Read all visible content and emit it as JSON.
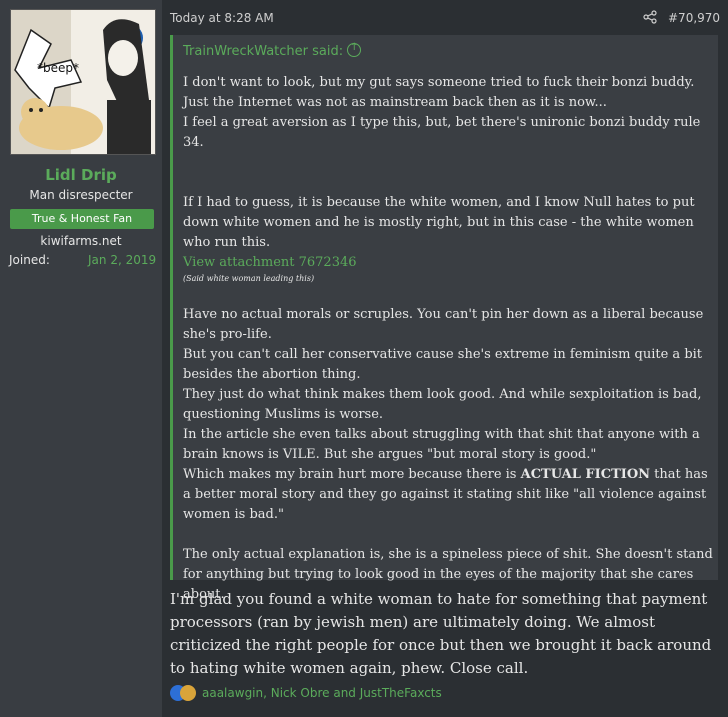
{
  "user": {
    "avatar_caption": "*beep*",
    "name": "Lidl Drip",
    "title": "Man disrespecter",
    "banner": "True & Honest Fan",
    "site": "kiwifarms.net",
    "joined_label": "Joined:",
    "joined_date": "Jan 2, 2019"
  },
  "post": {
    "timestamp": "Today at 8:28 AM",
    "number": "#70,970",
    "quote": {
      "author": "TrainWreckWatcher said:",
      "p1": "I don't want to look, but my gut says someone tried to fuck their bonzi buddy. Just the Internet was not as mainstream back then as it is now...",
      "p2": "I feel a great aversion as I type this, but, bet there's unironic bonzi buddy rule 34.",
      "p3": "If I had to guess, it is because the white women, and I know Null hates to put down white women and he is mostly right, but in this case - the white women who run this.",
      "attachment": "View attachment 7672346",
      "caption": "(Said white woman leading this)",
      "p4": "Have no actual morals or scruples. You can't pin her down as a liberal because she's pro-life.",
      "p5": "But you can't call her conservative cause she's extreme in feminism quite a bit besides the abortion thing.",
      "p6": "They just do what think makes them look good. And while sexploitation is bad, questioning Muslims is worse.",
      "p7": "In the article she even talks about struggling with that shit that anyone with a brain knows is VILE. But she argues \"but moral story is good.\"",
      "p8a": "Which makes my brain hurt more because there is ",
      "p8b": "ACTUAL FICTION",
      "p8c": " that has a better moral story and they go against it stating shit like \"all violence against women is bad.\"",
      "p9": "The only actual explanation is, she is a spineless piece of shit. She doesn't stand for anything but trying to look good in the eyes of the majority that she cares about."
    },
    "reply": "I'm glad you found a white woman to hate for something that payment processors (ran by jewish men) are ultimately doing. We almost criticized the right people for once but then we brought it back around to hating white women again, phew. Close call.",
    "reactions": "aaalawgin, Nick Obre and JustTheFaxcts"
  }
}
